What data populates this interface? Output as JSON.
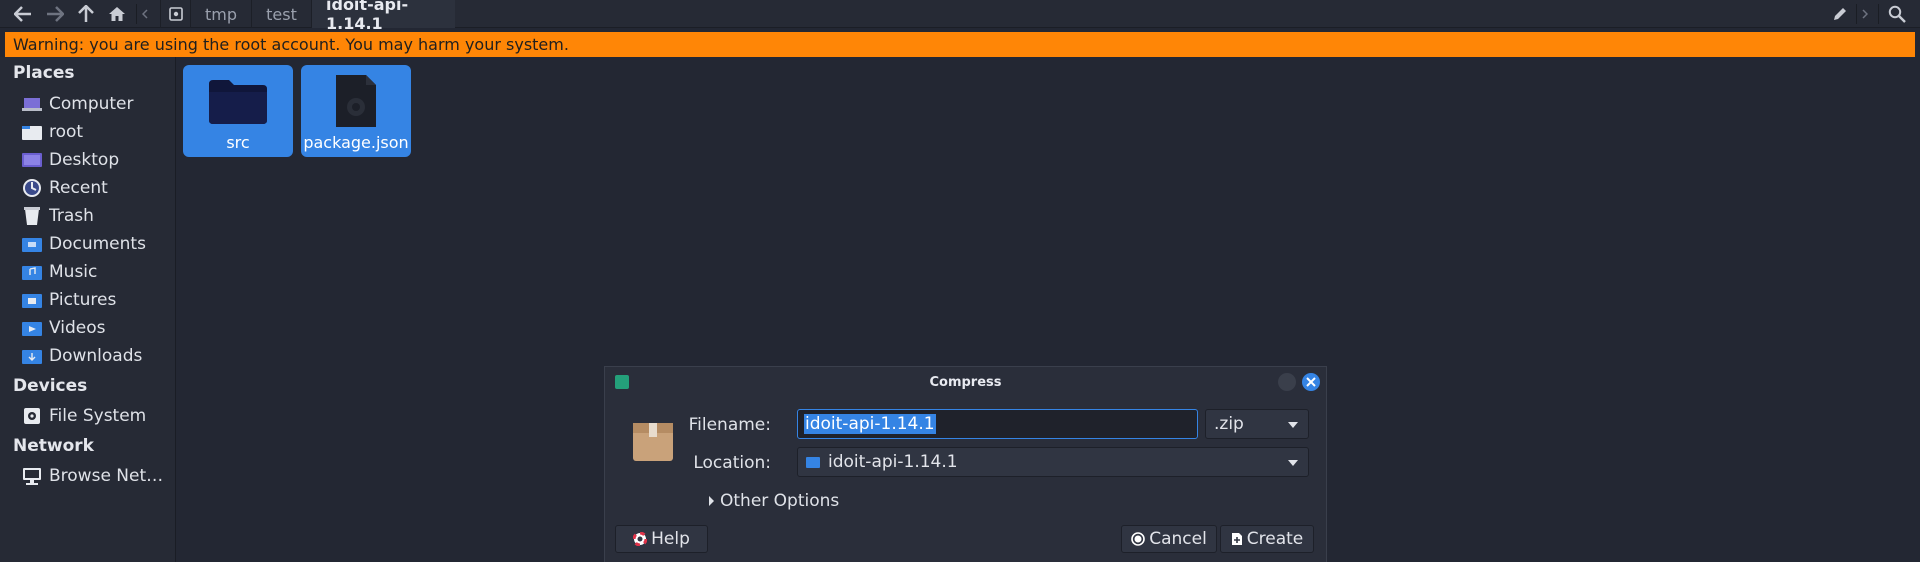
{
  "toolbar": {
    "path": [
      "tmp",
      "test",
      "idoit-api-1.14.1"
    ],
    "icons": [
      "back-icon",
      "forward-icon",
      "up-icon",
      "home-icon",
      "scroll-left-icon",
      "drive-icon",
      "edit-path-icon",
      "scroll-right-icon",
      "search-icon"
    ]
  },
  "warning": {
    "text": "Warning: you are using the root account. You may harm your system."
  },
  "sidebar": {
    "places_header": "Places",
    "places": [
      {
        "label": "Computer",
        "icon": "computer-icon"
      },
      {
        "label": "root",
        "icon": "home-folder-icon"
      },
      {
        "label": "Desktop",
        "icon": "desktop-icon"
      },
      {
        "label": "Recent",
        "icon": "recent-icon"
      },
      {
        "label": "Trash",
        "icon": "trash-icon"
      },
      {
        "label": "Documents",
        "icon": "documents-folder-icon"
      },
      {
        "label": "Music",
        "icon": "music-folder-icon"
      },
      {
        "label": "Pictures",
        "icon": "pictures-folder-icon"
      },
      {
        "label": "Videos",
        "icon": "videos-folder-icon"
      },
      {
        "label": "Downloads",
        "icon": "downloads-folder-icon"
      }
    ],
    "devices_header": "Devices",
    "devices": [
      {
        "label": "File System",
        "icon": "drive-icon"
      }
    ],
    "network_header": "Network",
    "network": [
      {
        "label": "Browse Net…",
        "icon": "network-icon"
      }
    ]
  },
  "files": [
    {
      "name": "src",
      "icon": "folder-icon"
    },
    {
      "name": "package.json",
      "icon": "json-file-icon"
    }
  ],
  "dialog": {
    "title": "Compress",
    "filename_label": "Filename:",
    "filename_value": "idoit-api-1.14.1",
    "extension": ".zip",
    "location_label": "Location:",
    "location_value": "idoit-api-1.14.1",
    "other_options": "Other Options",
    "help": "Help",
    "cancel": "Cancel",
    "create": "Create"
  },
  "colors": {
    "accent": "#3584e4",
    "warning": "#ff8606",
    "background": "#232733",
    "sidebar": "#262a35"
  }
}
